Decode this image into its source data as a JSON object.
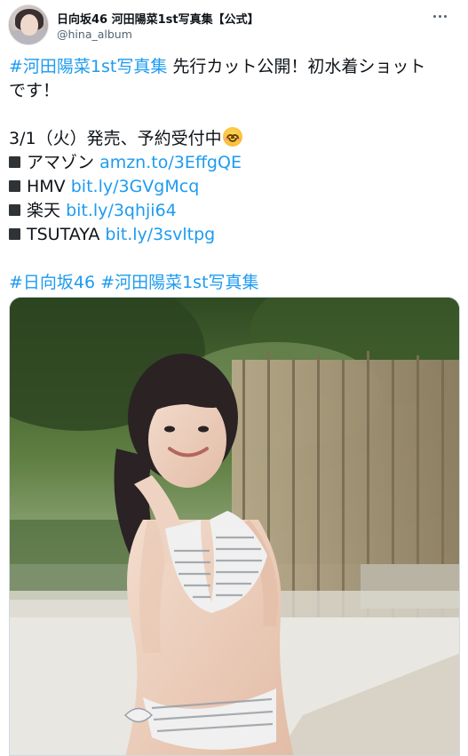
{
  "account": {
    "display_name": "日向坂46 河田陽菜1st写真集【公式】",
    "handle": "@hina_album"
  },
  "tweet": {
    "line1_hashtag": "#河田陽菜1st写真集",
    "line1_text": " 先行カット公開！初水着ショット",
    "line2_text": "です！",
    "release_line": "3/1（火）発売、予約受付中",
    "stores": [
      {
        "name": "アマゾン",
        "url": "amzn.to/3EffgQE"
      },
      {
        "name": "HMV",
        "url": "bit.ly/3GVgMcq"
      },
      {
        "name": "楽天",
        "url": "bit.ly/3qhji64"
      },
      {
        "name": "TSUTAYA",
        "url": "bit.ly/3svltpg"
      }
    ],
    "hashtags": [
      "#日向坂46",
      "#河田陽菜1st写真集"
    ]
  },
  "icons": {
    "more": "more-horizontal-icon",
    "bullet": "black-square-icon",
    "emoji": "smiling-face-emoji-icon"
  },
  "colors": {
    "link": "#1d9bf0",
    "text": "#0f1419",
    "secondary": "#536471"
  }
}
